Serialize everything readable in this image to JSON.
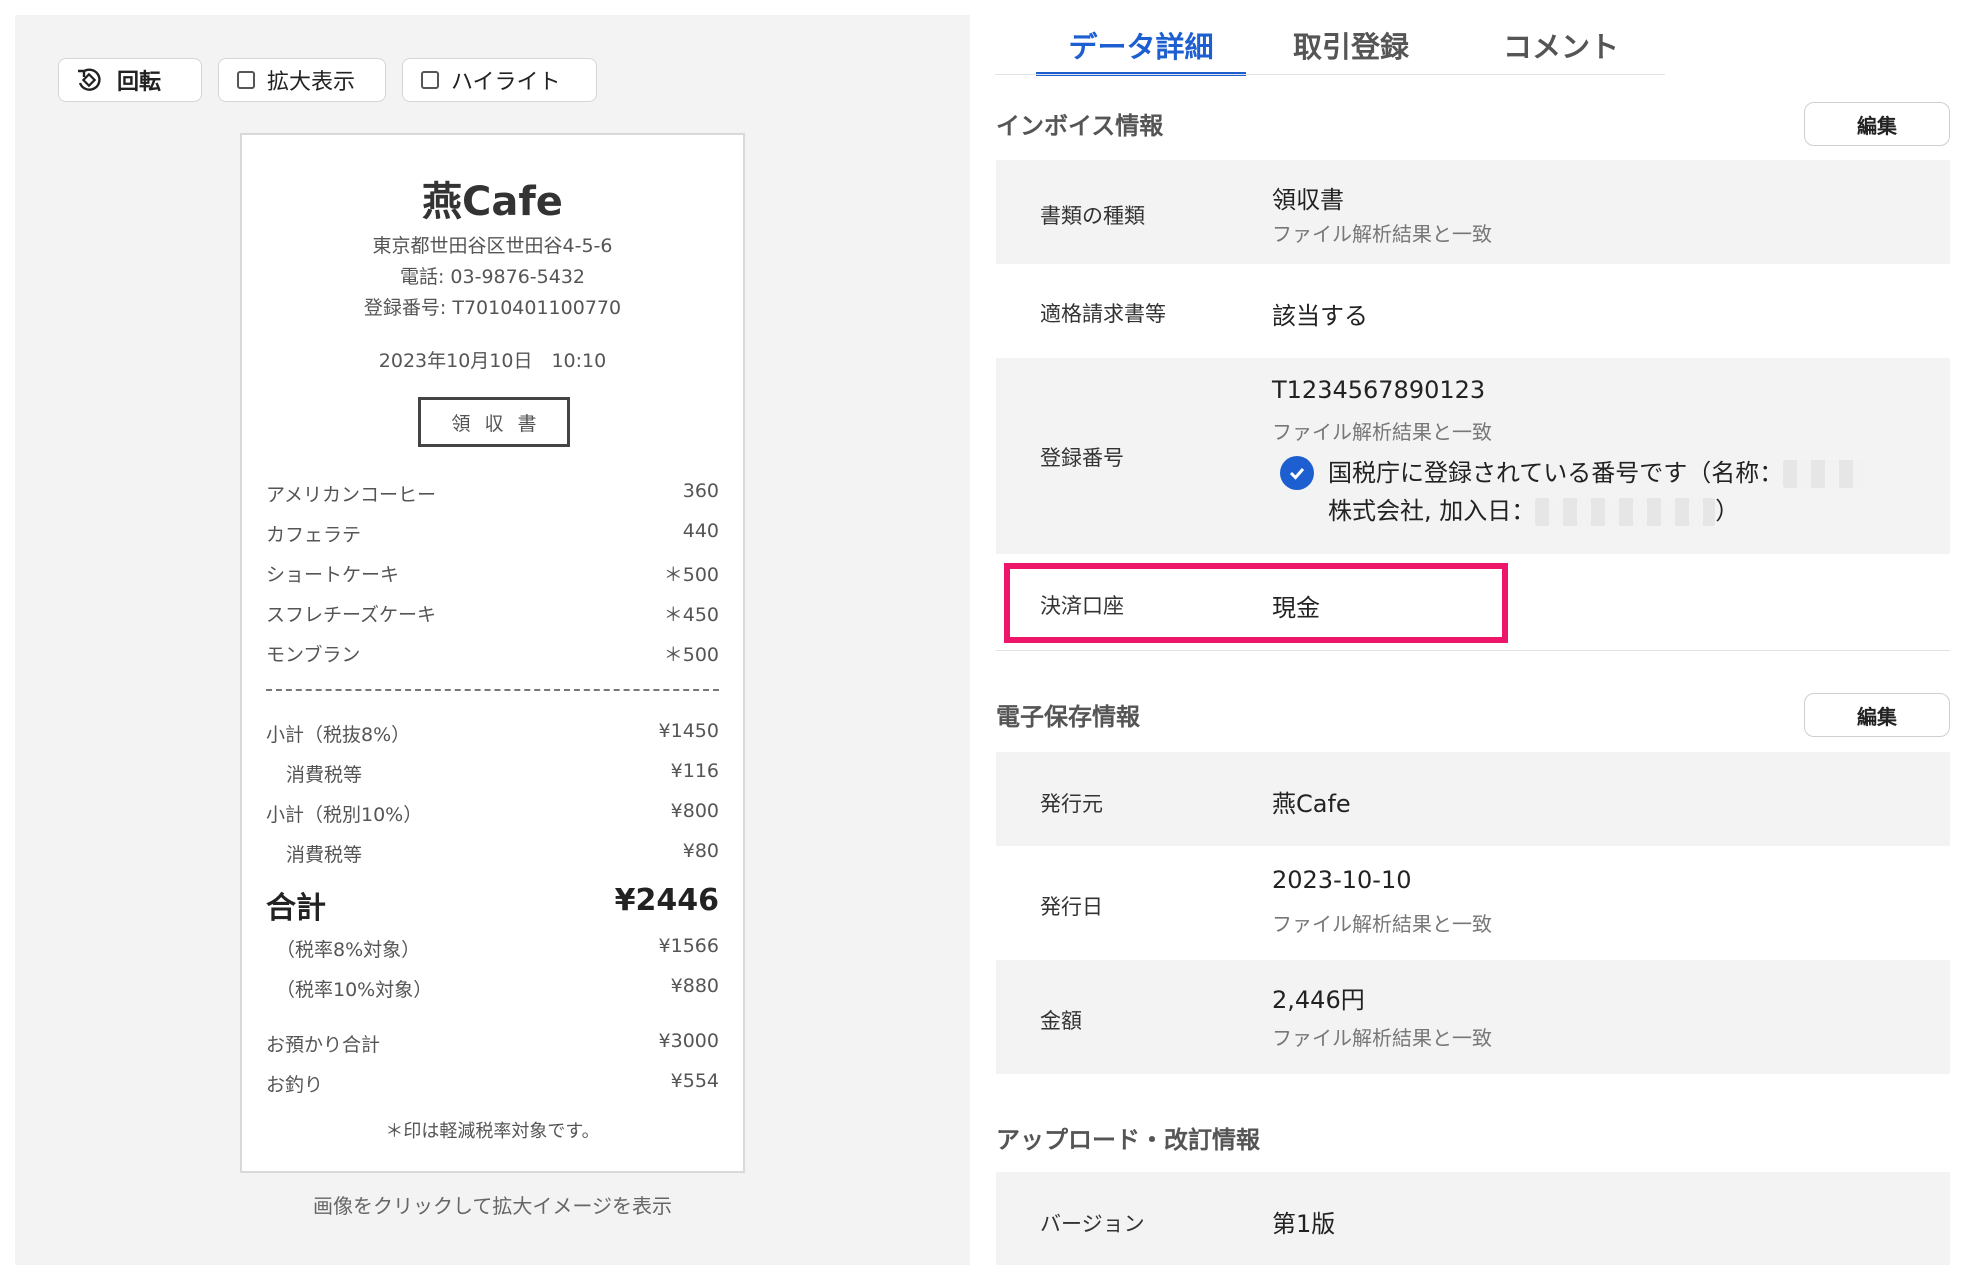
{
  "toolbar": {
    "rotate_label": "回転",
    "zoom_label": "拡大表示",
    "highlight_label": "ハイライト"
  },
  "receipt": {
    "store": "燕Cafe",
    "address": "東京都世田谷区世田谷4-5-6",
    "phone": "電話: 03-9876-5432",
    "registration": "登録番号: T7010401100770",
    "datetime": "2023年10月10日　10:10",
    "doc_title": "領収書",
    "items": [
      {
        "name": "アメリカンコーヒー",
        "price": "360"
      },
      {
        "name": "カフェラテ",
        "price": "440"
      },
      {
        "name": "ショートケーキ",
        "price": "＊500"
      },
      {
        "name": "スフレチーズケーキ",
        "price": "＊450"
      },
      {
        "name": "モンブラン",
        "price": "＊500"
      }
    ],
    "subtotal8_label": "小計（税抜8%）",
    "subtotal8": "¥1450",
    "tax8_label": "消費税等",
    "tax8": "¥116",
    "subtotal10_label": "小計（税別10%）",
    "subtotal10": "¥800",
    "tax10_label": "消費税等",
    "tax10": "¥80",
    "total_label": "合計",
    "total": "¥2446",
    "rate8_label": "（税率8%対象）",
    "rate8": "¥1566",
    "rate10_label": "（税率10%対象）",
    "rate10": "¥880",
    "received_label": "お預かり合計",
    "received": "¥3000",
    "change_label": "お釣り",
    "change": "¥554",
    "note": "＊印は軽減税率対象です。"
  },
  "caption": "画像をクリックして拡大イメージを表示",
  "tabs": [
    {
      "label": "データ詳細"
    },
    {
      "label": "取引登録"
    },
    {
      "label": "コメント"
    }
  ],
  "invoice": {
    "title": "インボイス情報",
    "edit_label": "編集",
    "doc_type_label": "書類の種類",
    "doc_type_value": "領収書",
    "doc_type_sub": "ファイル解析結果と一致",
    "qualified_label": "適格請求書等",
    "qualified_value": "該当する",
    "reg_label": "登録番号",
    "reg_value": "T1234567890123",
    "reg_sub": "ファイル解析結果と一致",
    "verify_line1": "国税庁に登録されている番号です（名称：",
    "verify_line2a": "株式会社, 加入日：",
    "verify_line2b": "）",
    "payment_label": "決済口座",
    "payment_value": "現金"
  },
  "storage": {
    "title": "電子保存情報",
    "edit_label": "編集",
    "issuer_label": "発行元",
    "issuer_value": "燕Cafe",
    "date_label": "発行日",
    "date_value": "2023-10-10",
    "date_sub": "ファイル解析結果と一致",
    "amount_label": "金額",
    "amount_value": "2,446円",
    "amount_sub": "ファイル解析結果と一致"
  },
  "upload": {
    "title": "アップロード・改訂情報",
    "version_label": "バージョン",
    "version_value": "第1版"
  },
  "colors": {
    "accent": "#1d5fd1",
    "highlight": "#ee1669",
    "panel": "#f3f3f3"
  }
}
